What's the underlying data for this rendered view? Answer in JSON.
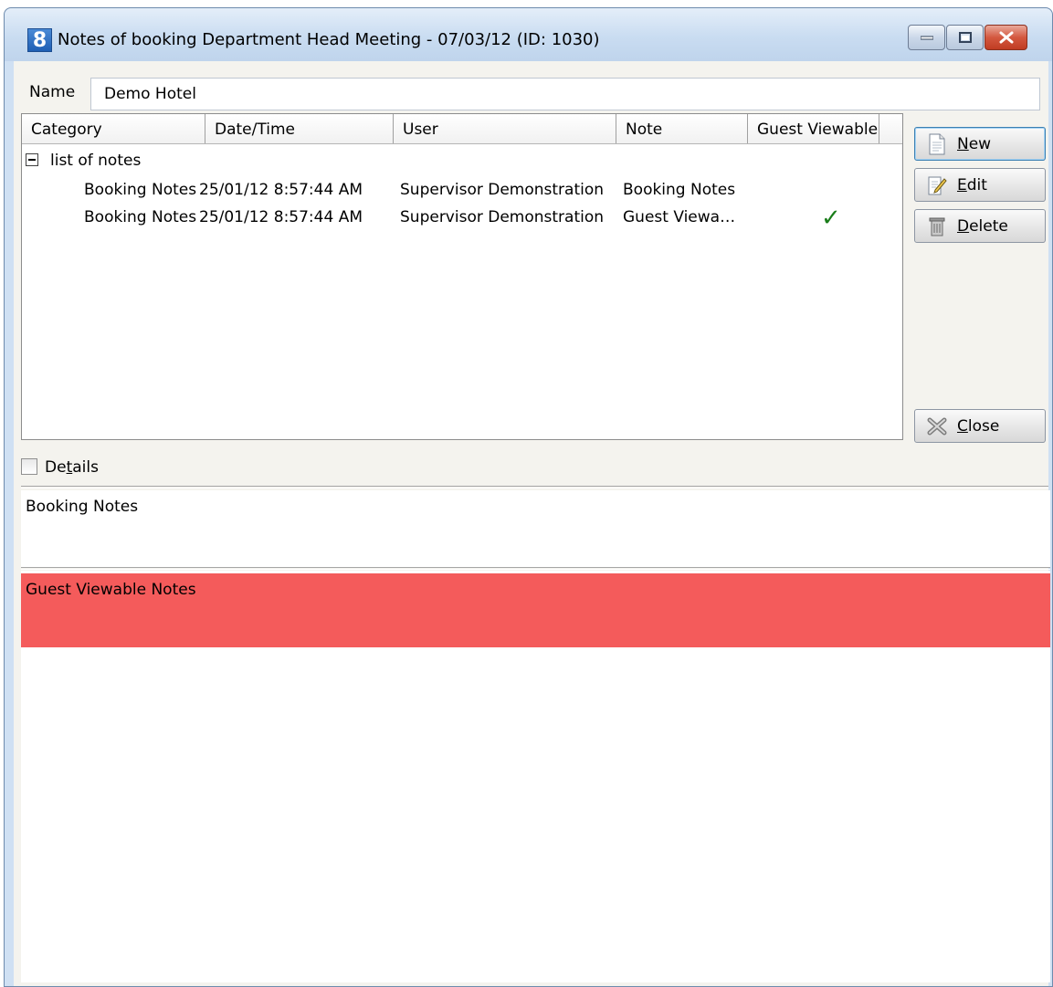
{
  "window": {
    "title": "Notes of booking Department Head Meeting - 07/03/12 (ID: 1030)",
    "app_icon_glyph": "8"
  },
  "name_field": {
    "label": "Name",
    "value": "Demo Hotel"
  },
  "grid": {
    "columns": [
      "Category",
      "Date/Time",
      "User",
      "Note",
      "Guest Viewable"
    ],
    "group_label": "list of notes",
    "rows": [
      {
        "category": "Booking Notes",
        "datetime": "25/01/12 8:57:44 AM",
        "user": "Supervisor Demonstration",
        "note": "Booking Notes",
        "guest_viewable": false
      },
      {
        "category": "Booking Notes",
        "datetime": "25/01/12 8:57:44 AM",
        "user": "Supervisor Demonstration",
        "note": "Guest Viewa…",
        "guest_viewable": true
      }
    ]
  },
  "buttons": {
    "new_label_u": "N",
    "new_label_rest": "ew",
    "edit_label_u": "E",
    "edit_label_rest": "dit",
    "delete_label_u": "D",
    "delete_label_rest": "elete",
    "close_label_u": "C",
    "close_label_rest": "lose"
  },
  "details": {
    "label_pre": "De",
    "label_u": "t",
    "label_post": "ails",
    "checked": false
  },
  "notes_text": "Booking Notes",
  "guest_notes_text": "Guest Viewable Notes",
  "colors": {
    "guest_band": "#f45b5b",
    "check": "#1a7d1a"
  },
  "check_glyph": "✓"
}
